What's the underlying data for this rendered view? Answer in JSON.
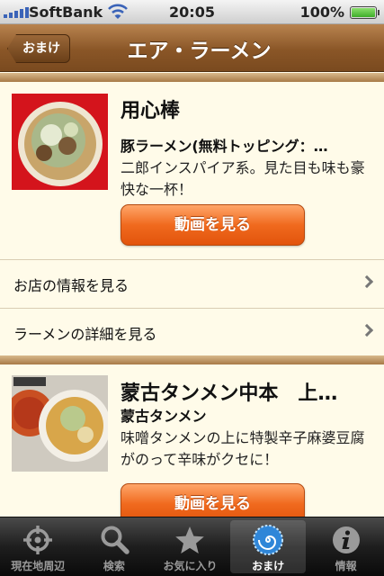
{
  "status_bar": {
    "carrier": "SoftBank",
    "time": "20:05",
    "battery": "100%"
  },
  "nav": {
    "back_label": "おまけ",
    "title": "エア・ラーメン"
  },
  "shops": [
    {
      "name": "用心棒",
      "menu": "豚ラーメン(無料トッピング：…",
      "description": "二郎インスパイア系。見た目も味も豪快な一杯！",
      "video_button": "動画を見る",
      "rows": [
        "お店の情報を見る",
        "ラーメンの詳細を見る"
      ]
    },
    {
      "name": "蒙古タンメン中本　上…",
      "menu": "蒙古タンメン",
      "description": "味噌タンメンの上に特製辛子麻婆豆腐がのって辛味がクセに！",
      "video_button": "動画を見る",
      "rows": []
    }
  ],
  "tabs": [
    {
      "label": "現在地周辺",
      "icon": "location-target-icon",
      "selected": false
    },
    {
      "label": "検索",
      "icon": "search-icon",
      "selected": false
    },
    {
      "label": "お気に入り",
      "icon": "star-icon",
      "selected": false
    },
    {
      "label": "おまけ",
      "icon": "spiral-icon",
      "selected": true
    },
    {
      "label": "情報",
      "icon": "info-icon",
      "selected": false
    }
  ],
  "colors": {
    "nav_brown": "#8a5627",
    "button_orange": "#f06a1e",
    "background": "#fffbe9"
  }
}
